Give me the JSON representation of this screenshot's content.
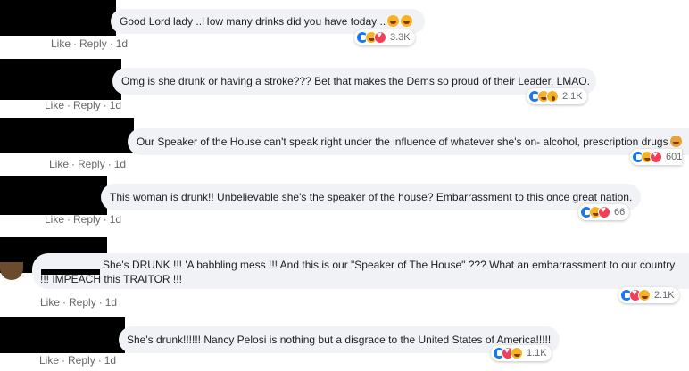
{
  "comments": [
    {
      "text": "Good Lord lady ..How many drinks did you have today ..",
      "inline_emoji": [
        "rolling-laughing",
        "rolling-laughing"
      ],
      "reaction_icons": [
        "like",
        "haha",
        "love"
      ],
      "reaction_count": "3.3K",
      "actions": {
        "like": "Like",
        "reply": "Reply",
        "time": "1d"
      }
    },
    {
      "text": "Omg is she drunk or having a stroke??? Bet that makes the Dems so proud of their Leader, LMAO.",
      "reaction_icons": [
        "like",
        "haha",
        "wow"
      ],
      "reaction_count": "2.1K",
      "actions": {
        "like": "Like",
        "reply": "Reply",
        "time": "1d"
      }
    },
    {
      "text": "Our Speaker of the House can't speak right under the influence of whatever she's on- alcohol, prescription drugs",
      "inline_emoji": [
        "person-facepalming"
      ],
      "reaction_icons": [
        "like",
        "haha",
        "love"
      ],
      "reaction_count": "601",
      "actions": {
        "like": "Like",
        "reply": "Reply",
        "time": "1d"
      }
    },
    {
      "text": "This woman is drunk!! Unbelievable she's the speaker of the house? Embarrassment to this once great nation.",
      "reaction_icons": [
        "like",
        "haha",
        "love"
      ],
      "reaction_count": "66",
      "actions": {
        "like": "Like",
        "reply": "Reply",
        "time": "1d"
      }
    },
    {
      "text_line1": "She's DRUNK !!! 'A babbling mess !!! And this is our \"Speaker of The House\" ??? What an embarrassment to our country",
      "text_line2": "!!! IMPEACH this TRAITOR !!!",
      "reaction_icons": [
        "like",
        "love",
        "haha"
      ],
      "reaction_count": "2.1K",
      "actions": {
        "like": "Like",
        "reply": "Reply",
        "time": "1d"
      }
    },
    {
      "text": "She's drunk!!!!!! Nancy Pelosi is nothing but a disgrace to the United States of America!!!!!",
      "reaction_icons": [
        "like",
        "love",
        "haha"
      ],
      "reaction_count": "1.1K",
      "actions": {
        "like": "Like",
        "reply": "Reply",
        "time": "1d"
      }
    }
  ],
  "colors": {
    "bubble_bg": "#f0f2f5",
    "action_text": "#65676b",
    "like_blue": "#1877f2",
    "love_red": "#f33e58",
    "haha_yellow": "#f7b125",
    "redaction": "#000000"
  }
}
